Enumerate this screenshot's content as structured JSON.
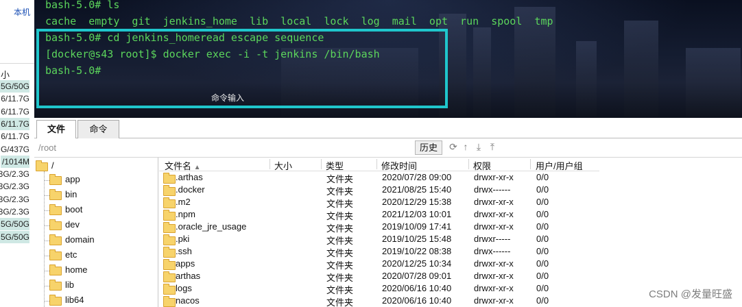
{
  "left_panel": {
    "title": "本机",
    "header": "小",
    "disk_rows": [
      {
        "text": "5G/50G",
        "hl": true
      },
      {
        "text": "6/11.7G",
        "hl": false
      },
      {
        "text": "6/11.7G",
        "hl": false
      },
      {
        "text": "6/11.7G",
        "hl": true
      },
      {
        "text": "6/11.7G",
        "hl": false
      },
      {
        "text": "G/437G",
        "hl": false
      },
      {
        "text": "/1014M",
        "hl": true
      },
      {
        "text": "3G/2.3G",
        "hl": false
      },
      {
        "text": "3G/2.3G",
        "hl": false
      },
      {
        "text": "3G/2.3G",
        "hl": false
      },
      {
        "text": "3G/2.3G",
        "hl": false
      },
      {
        "text": "5G/50G",
        "hl": true
      },
      {
        "text": "5G/50G",
        "hl": true
      }
    ]
  },
  "terminal": {
    "lines": [
      "bash-5.0# ls",
      "cache  empty  git  jenkins_home  lib  local  lock  log  mail  opt  run  spool  tmp",
      "bash-5.0# cd jenkins_homeread escape sequence",
      "[docker@s43 root]$ docker exec -i -t jenkins /bin/bash",
      "bash-5.0#"
    ],
    "command_input_label": "命令输入",
    "text_color": "#5cd65c",
    "highlight_color": "#1fc6cc"
  },
  "tabs": [
    {
      "label": "文件",
      "active": true
    },
    {
      "label": "命令",
      "active": false
    }
  ],
  "pathbar": {
    "path": "/root",
    "history_label": "历史",
    "icons": [
      "refresh-icon",
      "up-arrow-icon",
      "download-icon",
      "upload-icon"
    ]
  },
  "tree": {
    "root": "/",
    "items": [
      "app",
      "bin",
      "boot",
      "dev",
      "domain",
      "etc",
      "home",
      "lib",
      "lib64"
    ]
  },
  "filelist": {
    "headers": {
      "name": "文件名",
      "sort": "▲",
      "size": "大小",
      "type": "类型",
      "mtime": "修改时间",
      "perm": "权限",
      "owner": "用户/用户组"
    },
    "rows": [
      {
        "name": ".arthas",
        "type": "文件夹",
        "mtime": "2020/07/28 09:00",
        "perm": "drwxr-xr-x",
        "owner": "0/0"
      },
      {
        "name": ".docker",
        "type": "文件夹",
        "mtime": "2021/08/25 15:40",
        "perm": "drwx------",
        "owner": "0/0"
      },
      {
        "name": ".m2",
        "type": "文件夹",
        "mtime": "2020/12/29 15:38",
        "perm": "drwxr-xr-x",
        "owner": "0/0"
      },
      {
        "name": ".npm",
        "type": "文件夹",
        "mtime": "2021/12/03 10:01",
        "perm": "drwxr-xr-x",
        "owner": "0/0"
      },
      {
        "name": ".oracle_jre_usage",
        "type": "文件夹",
        "mtime": "2019/10/09 17:41",
        "perm": "drwxr-xr-x",
        "owner": "0/0"
      },
      {
        "name": ".pki",
        "type": "文件夹",
        "mtime": "2019/10/25 15:48",
        "perm": "drwxr-----",
        "owner": "0/0"
      },
      {
        "name": ".ssh",
        "type": "文件夹",
        "mtime": "2019/10/22 08:38",
        "perm": "drwx------",
        "owner": "0/0"
      },
      {
        "name": "apps",
        "type": "文件夹",
        "mtime": "2020/12/25 10:34",
        "perm": "drwxr-xr-x",
        "owner": "0/0"
      },
      {
        "name": "arthas",
        "type": "文件夹",
        "mtime": "2020/07/28 09:01",
        "perm": "drwxr-xr-x",
        "owner": "0/0"
      },
      {
        "name": "logs",
        "type": "文件夹",
        "mtime": "2020/06/16 10:40",
        "perm": "drwxr-xr-x",
        "owner": "0/0"
      },
      {
        "name": "nacos",
        "type": "文件夹",
        "mtime": "2020/06/16 10:40",
        "perm": "drwxr-xr-x",
        "owner": "0/0"
      }
    ]
  },
  "watermark": "CSDN @发量旺盛"
}
